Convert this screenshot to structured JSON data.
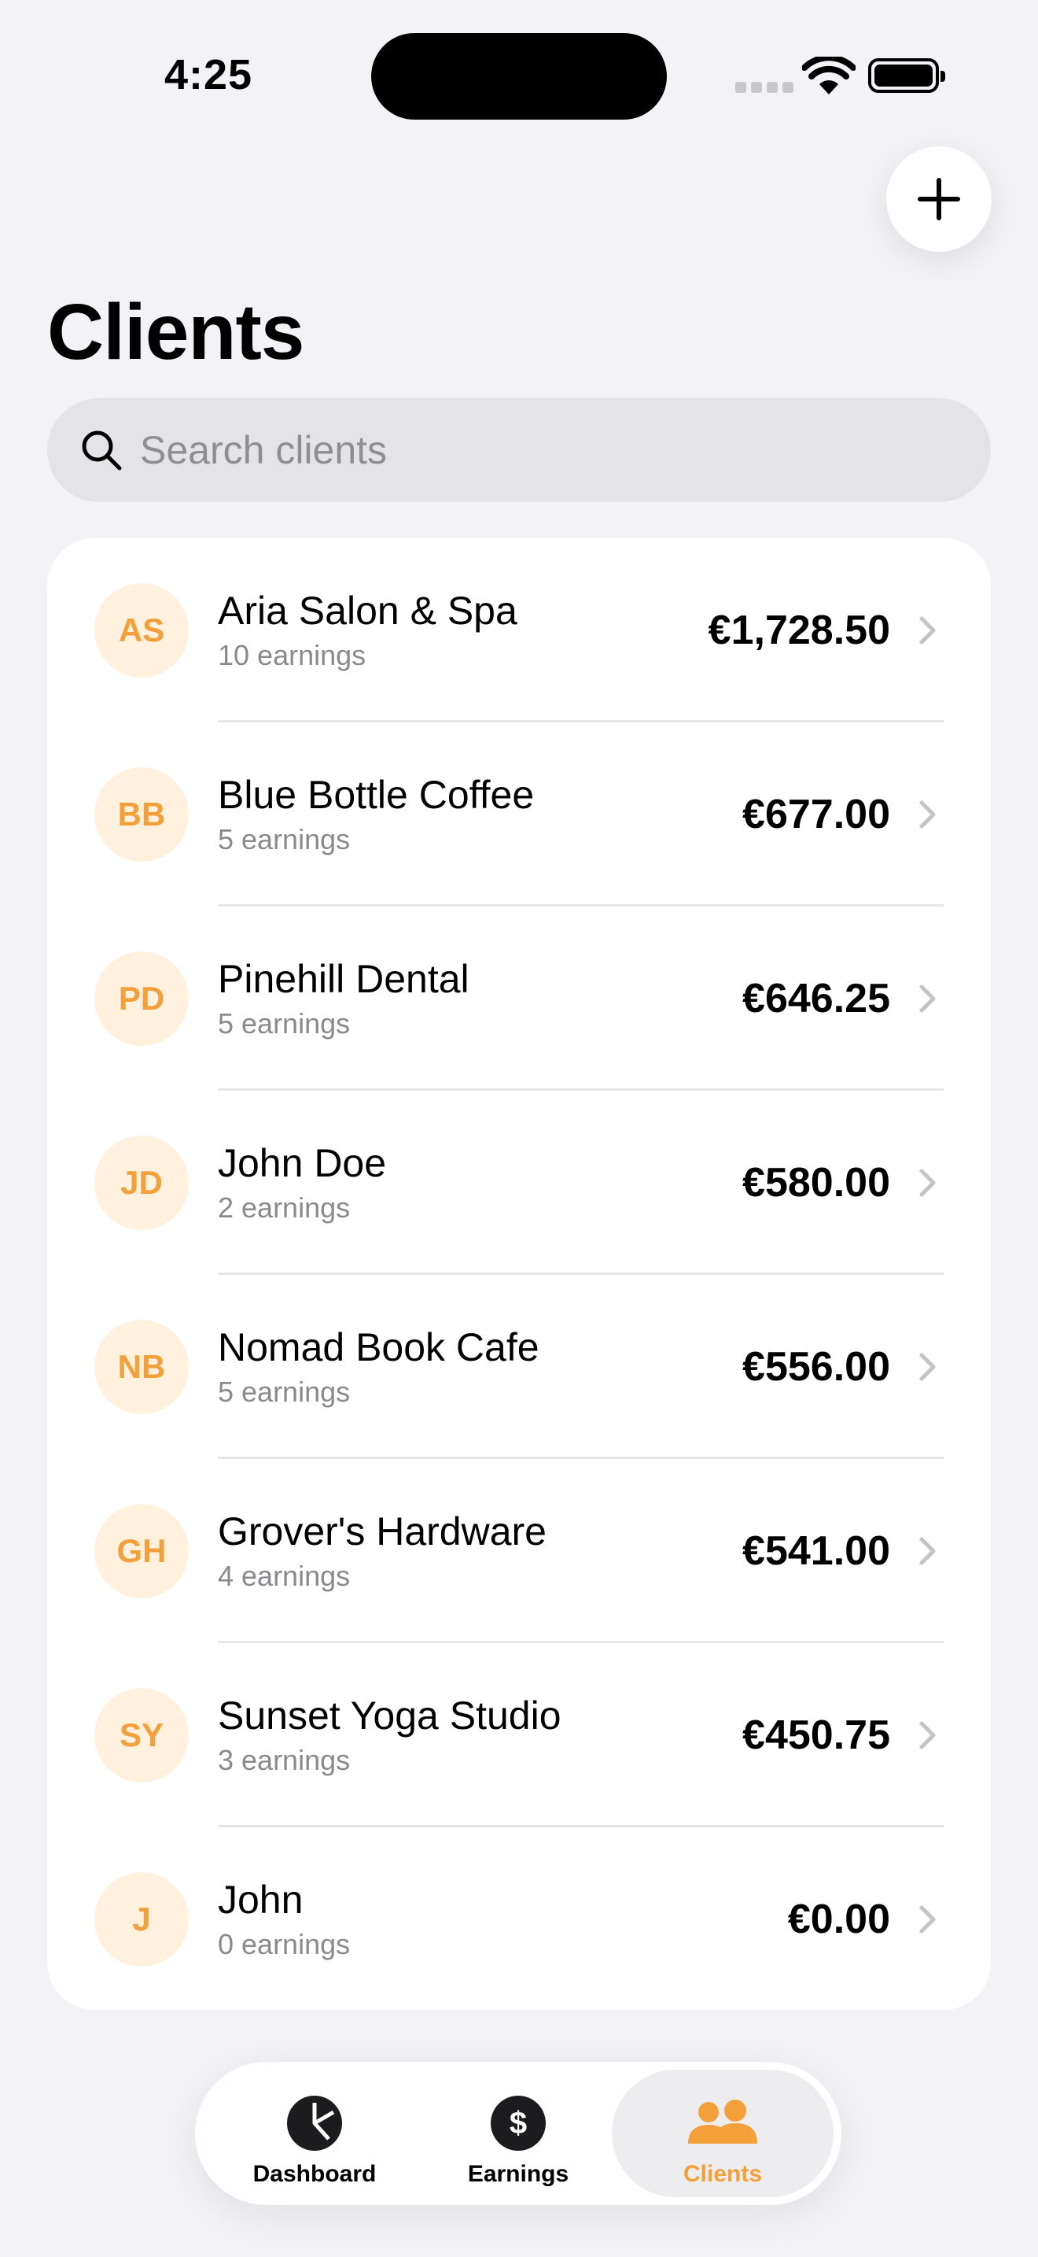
{
  "status": {
    "time": "4:25"
  },
  "header": {
    "title": "Clients"
  },
  "search": {
    "placeholder": "Search clients",
    "value": ""
  },
  "clients": [
    {
      "initials": "AS",
      "name": "Aria Salon & Spa",
      "earnings": "10 earnings",
      "amount": "€1,728.50"
    },
    {
      "initials": "BB",
      "name": "Blue Bottle Coffee",
      "earnings": "5 earnings",
      "amount": "€677.00"
    },
    {
      "initials": "PD",
      "name": "Pinehill Dental",
      "earnings": "5 earnings",
      "amount": "€646.25"
    },
    {
      "initials": "JD",
      "name": "John Doe",
      "earnings": "2 earnings",
      "amount": "€580.00"
    },
    {
      "initials": "NB",
      "name": "Nomad Book Cafe",
      "earnings": "5 earnings",
      "amount": "€556.00"
    },
    {
      "initials": "GH",
      "name": "Grover's Hardware",
      "earnings": "4 earnings",
      "amount": "€541.00"
    },
    {
      "initials": "SY",
      "name": "Sunset Yoga Studio",
      "earnings": "3 earnings",
      "amount": "€450.75"
    },
    {
      "initials": "J",
      "name": "John",
      "earnings": "0 earnings",
      "amount": "€0.00"
    }
  ],
  "tabs": [
    {
      "label": "Dashboard",
      "icon": "pie-chart-icon",
      "active": false
    },
    {
      "label": "Earnings",
      "icon": "dollar-icon",
      "active": false
    },
    {
      "label": "Clients",
      "icon": "people-icon",
      "active": true
    }
  ],
  "colors": {
    "accent": "#F4A03A",
    "avatar_bg": "#FFF1DE",
    "background": "#F2F2F7"
  }
}
